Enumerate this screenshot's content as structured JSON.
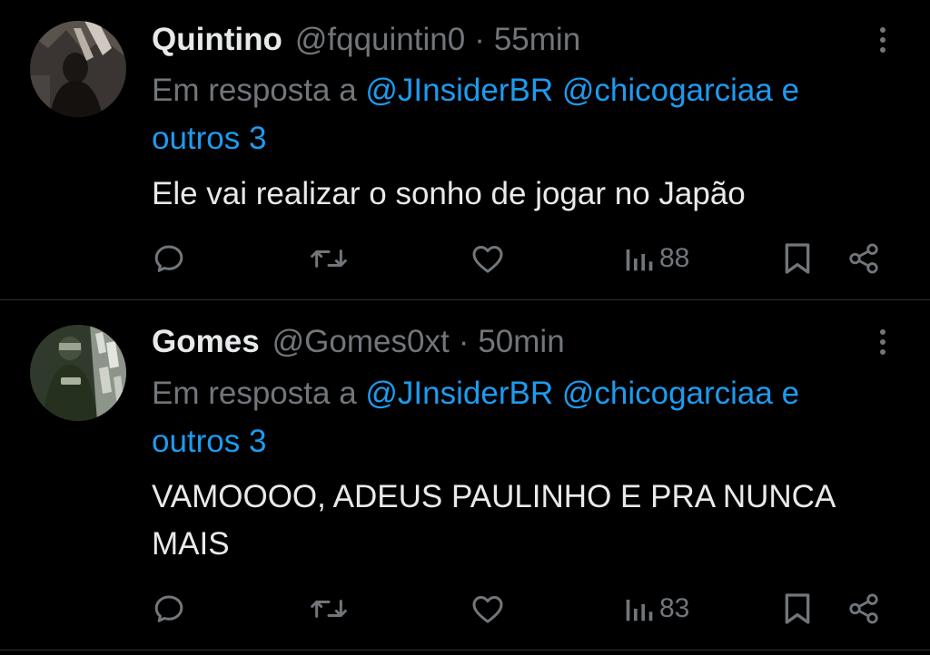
{
  "reply_prefix": "Em resposta a",
  "colors": {
    "background": "#000000",
    "primary_text": "#e7e9ea",
    "secondary_text": "#71767b",
    "link": "#1d9bf0",
    "divider": "#2f3336"
  },
  "tweets": [
    {
      "display_name": "Quintino",
      "handle": "@fqquintin0",
      "separator": "·",
      "time": "55min",
      "mentions": [
        "@JInsiderBR",
        "@chicogarciaa"
      ],
      "mentions_suffix": "e outros 3",
      "text": "Ele vai realizar o sonho de jogar no Japão",
      "views": "88",
      "icons": [
        "reply-icon",
        "retweet-icon",
        "like-icon",
        "views-icon",
        "bookmark-icon",
        "share-icon",
        "more-icon"
      ]
    },
    {
      "display_name": "Gomes",
      "handle": "@Gomes0xt",
      "separator": "·",
      "time": "50min",
      "mentions": [
        "@JInsiderBR",
        "@chicogarciaa"
      ],
      "mentions_suffix": "e outros 3",
      "text": "VAMOOOO, ADEUS PAULINHO E PRA NUNCA MAIS",
      "views": "83",
      "icons": [
        "reply-icon",
        "retweet-icon",
        "like-icon",
        "views-icon",
        "bookmark-icon",
        "share-icon",
        "more-icon"
      ]
    }
  ]
}
